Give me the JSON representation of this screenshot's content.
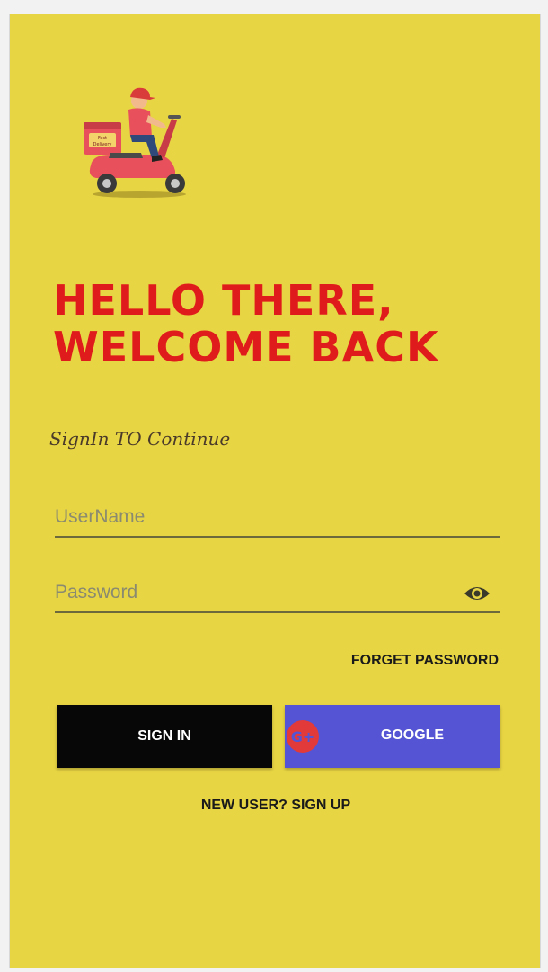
{
  "header": {
    "title_line1": "HELLO THERE,",
    "title_line2": "WELCOME BACK",
    "subtitle": "SignIn TO Continue"
  },
  "logo": {
    "icon": "delivery-scooter-icon",
    "text": "Fast Delivery"
  },
  "form": {
    "username_placeholder": "UserName",
    "username_value": "",
    "password_placeholder": "Password",
    "password_value": "",
    "password_toggle_icon": "eye-icon",
    "forget_password_label": "FORGET PASSWORD"
  },
  "actions": {
    "signin_label": "SIGN IN",
    "google_label": "GOOGLE",
    "google_icon": "google-plus-icon",
    "signup_label": "NEW USER? SIGN UP"
  },
  "colors": {
    "background": "#e8d543",
    "title": "#e01b1b",
    "signin_bg": "#070707",
    "google_bg": "#5454d4",
    "google_icon": "#e23a3a"
  }
}
